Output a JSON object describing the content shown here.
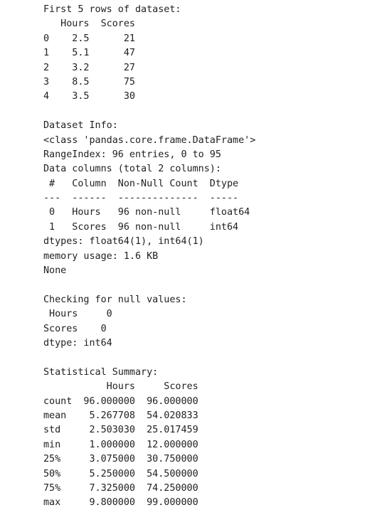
{
  "output": {
    "lines": [
      "First 5 rows of dataset:",
      "   Hours  Scores",
      "0    2.5      21",
      "1    5.1      47",
      "2    3.2      27",
      "3    8.5      75",
      "4    3.5      30",
      "",
      "Dataset Info:",
      "<class 'pandas.core.frame.DataFrame'>",
      "RangeIndex: 96 entries, 0 to 95",
      "Data columns (total 2 columns):",
      " #   Column  Non-Null Count  Dtype  ",
      "---  ------  --------------  -----  ",
      " 0   Hours   96 non-null     float64",
      " 1   Scores  96 non-null     int64  ",
      "dtypes: float64(1), int64(1)",
      "memory usage: 1.6 KB",
      "None",
      "",
      "Checking for null values:",
      " Hours     0",
      "Scores    0",
      "dtype: int64",
      "",
      "Statistical Summary:",
      "           Hours     Scores",
      "count  96.000000  96.000000",
      "mean    5.267708  54.020833",
      "std     2.503030  25.017459",
      "min     1.000000  12.000000",
      "25%     3.075000  30.750000",
      "50%     5.250000  54.500000",
      "75%     7.325000  74.250000",
      "max     9.800000  99.000000"
    ]
  }
}
